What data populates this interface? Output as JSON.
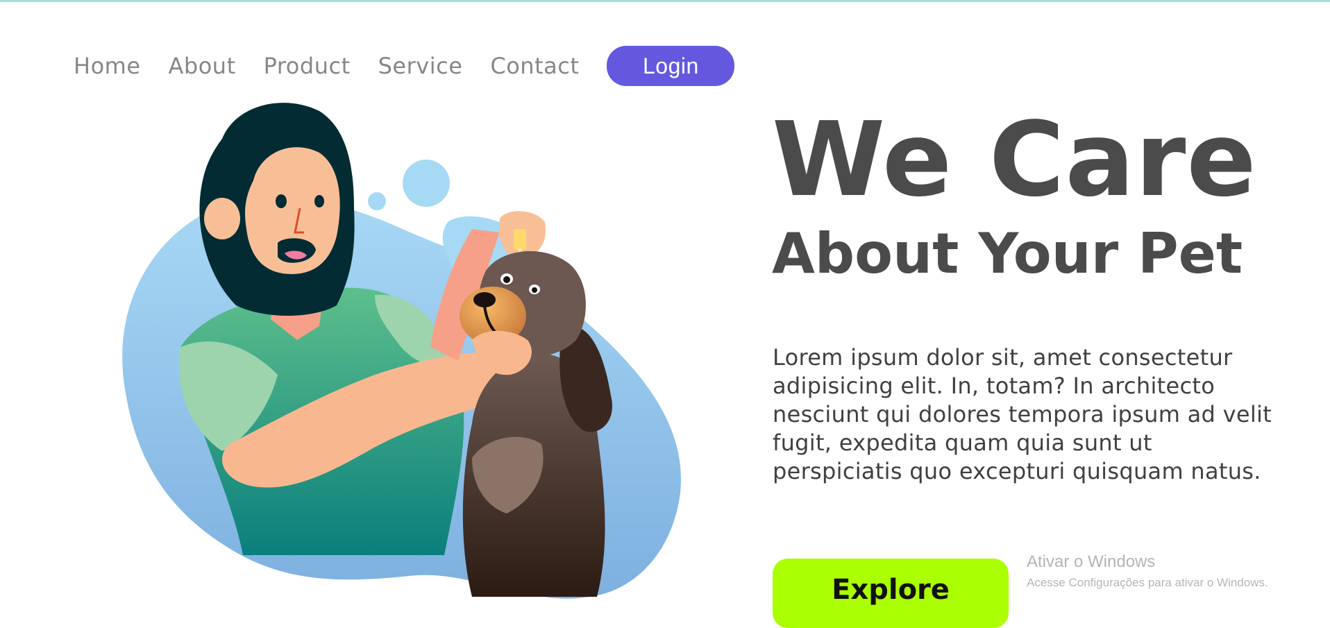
{
  "nav": {
    "items": [
      {
        "label": "Home"
      },
      {
        "label": "About"
      },
      {
        "label": "Product"
      },
      {
        "label": "Service"
      },
      {
        "label": "Contact"
      }
    ],
    "login_label": "Login"
  },
  "hero": {
    "title": "We Care",
    "subtitle": "About Your Pet",
    "body": "Lorem ipsum dolor sit, amet consectetur adipisicing elit. In, totam? In architecto nesciunt qui dolores tempora ipsum ad velit fugit, expedita quam quia sunt ut perspiciatis quo excepturi quisquam natus.",
    "cta_label": "Explore",
    "illustration_icon": "vet-dog-illustration"
  },
  "windows_watermark": {
    "title": "Ativar o Windows",
    "subtitle": "Acesse Configurações para ativar o Windows."
  },
  "colors": {
    "accent": "#6459de",
    "cta": "#aaff00",
    "heading": "#4b4b4b",
    "nav_text": "#878787"
  }
}
